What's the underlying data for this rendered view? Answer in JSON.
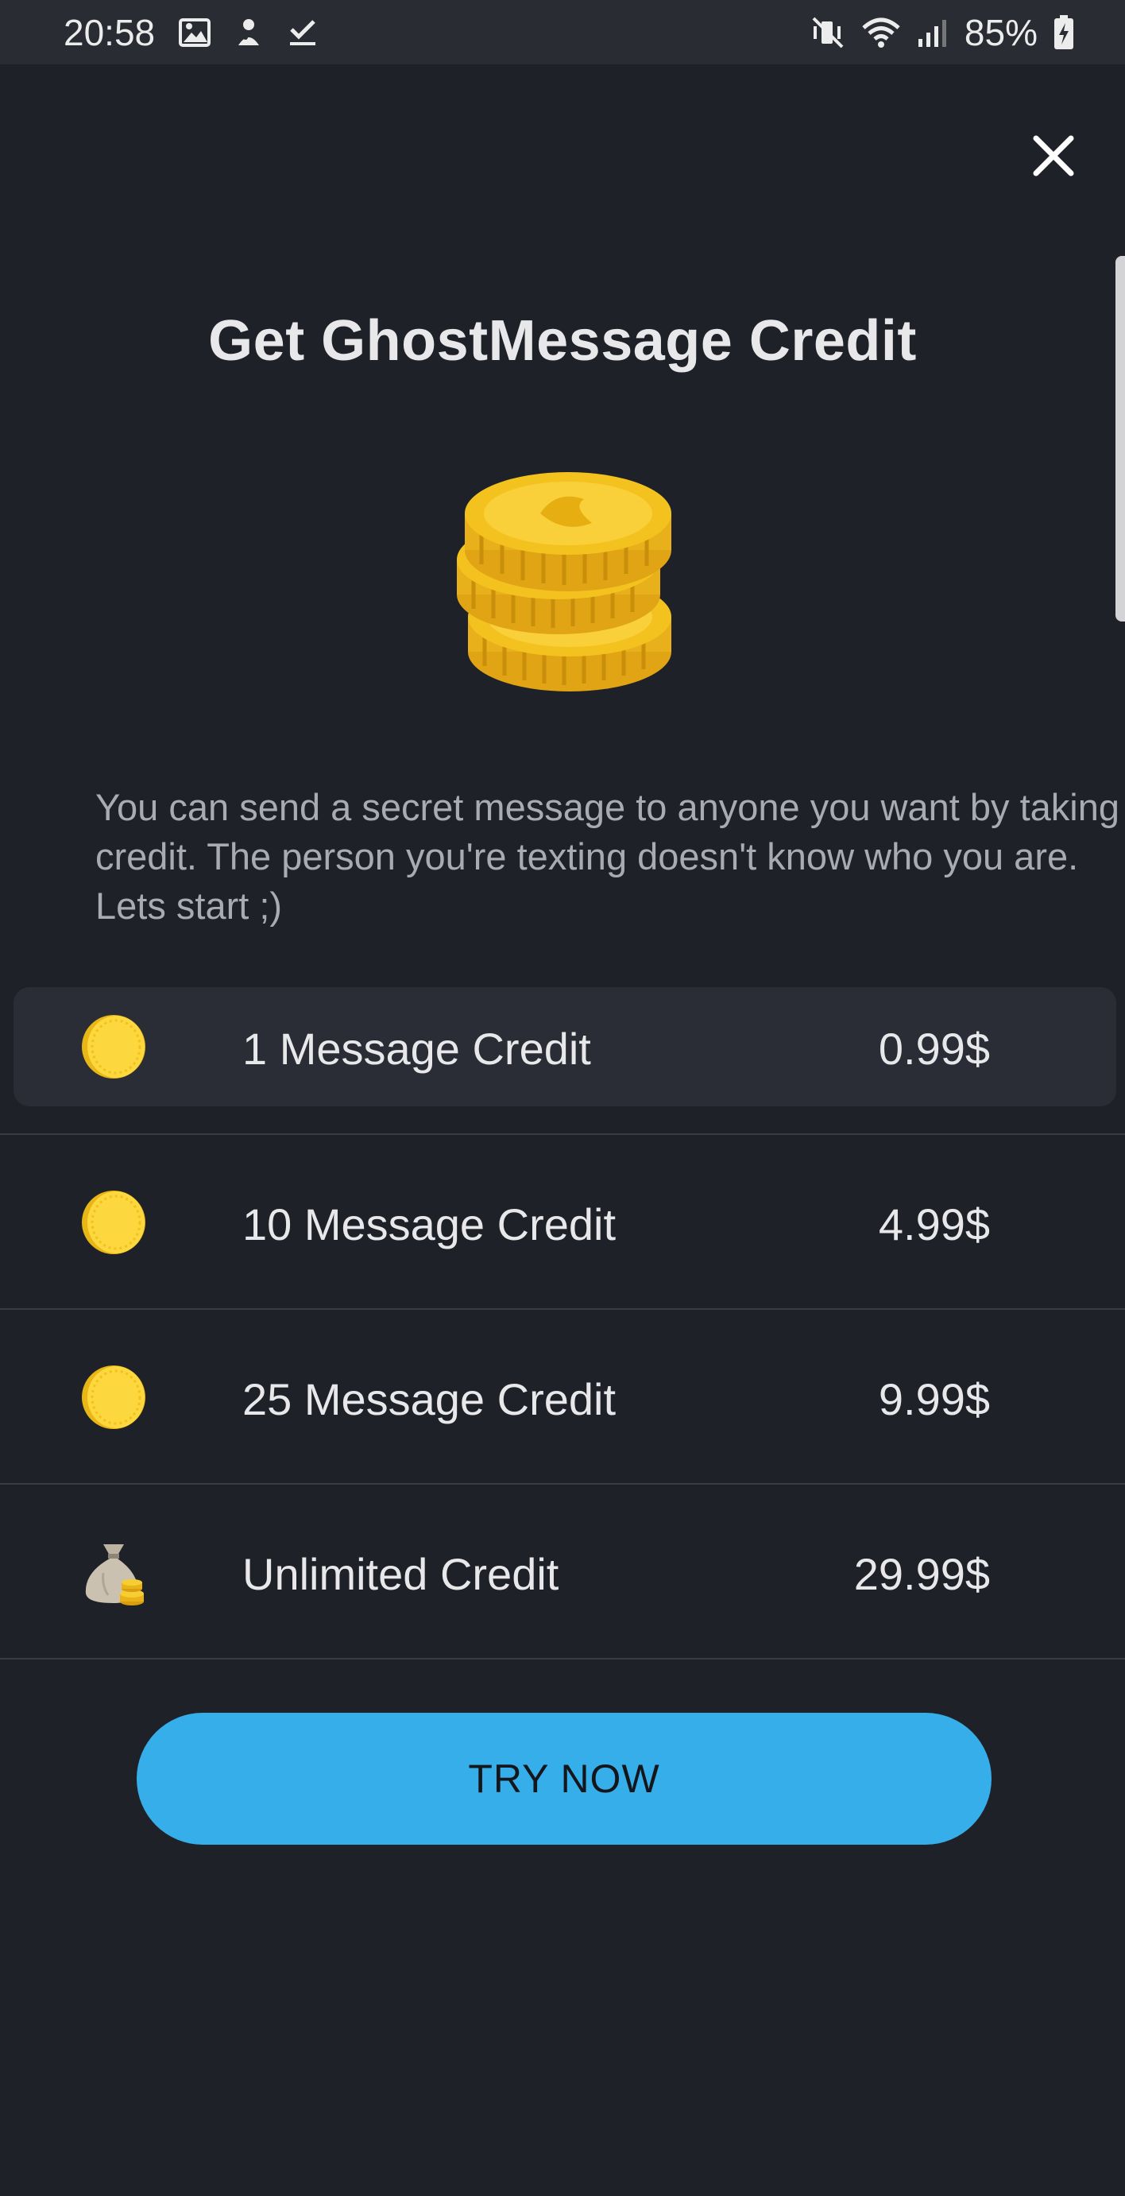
{
  "status_bar": {
    "time": "20:58",
    "battery": "85%",
    "left_icons": [
      "gallery-icon",
      "app-notification-icon",
      "checkmark-icon"
    ],
    "right_icons": [
      "vibrate-mute-icon",
      "wifi-icon",
      "signal-icon",
      "battery-charging-icon"
    ]
  },
  "close_icon": "close-icon",
  "title": "Get GhostMessage Credit",
  "hero_icon": "coin-stack-icon",
  "description": "You can send a secret message to anyone you want by taking credit. The person you're texting doesn't know who you are. Lets start ;)",
  "plans": [
    {
      "icon": "coin-icon",
      "label": "1 Message Credit",
      "price": "0.99$",
      "selected": true
    },
    {
      "icon": "coin-icon",
      "label": "10 Message Credit",
      "price": "4.99$",
      "selected": false
    },
    {
      "icon": "coin-icon",
      "label": "25 Message Credit",
      "price": "9.99$",
      "selected": false
    },
    {
      "icon": "money-bag-icon",
      "label": "Unlimited Credit",
      "price": "29.99$",
      "selected": false
    }
  ],
  "cta_label": "TRY NOW",
  "colors": {
    "background": "#1f2129",
    "status_bar": "#2a2c33",
    "selected_row": "#2a2d36",
    "accent": "#36aee9",
    "coin": "#f5c518"
  }
}
